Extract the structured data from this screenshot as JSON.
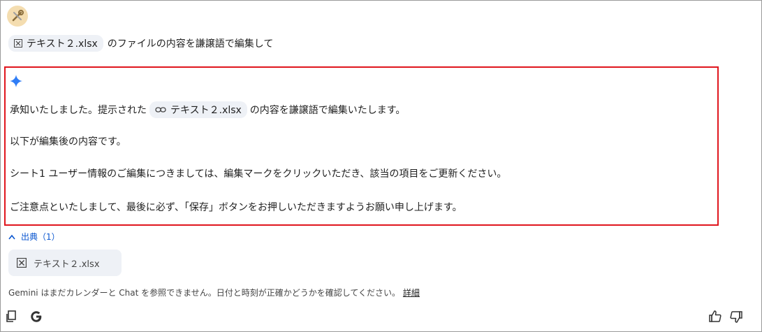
{
  "prompt": {
    "file_chip": "テキスト２.xlsx",
    "text": "のファイルの内容を謙譲語で編集して"
  },
  "response": {
    "line1_before": "承知いたしました。提示された",
    "line1_chip": "テキスト２.xlsx",
    "line1_after": "の内容を謙譲語で編集いたします。",
    "line2": "以下が編集後の内容です。",
    "line3": "シート1 ユーザー情報のご編集につきましては、編集マークをクリックいただき、該当の項目をご更新ください。",
    "line4": "ご注意点といたしまして、最後に必ず、「保存」ボタンをお押しいただきますようお願い申し上げます。"
  },
  "sources": {
    "toggle_label": "出典（1）",
    "items": [
      "テキスト２.xlsx"
    ]
  },
  "footnote": {
    "text": "Gemini はまだカレンダーと Chat を参照できません。日付と時刻が正確かどうかを確認してください。",
    "link": "詳細"
  },
  "colors": {
    "accent": "#0b57d0",
    "highlight_border": "#e0161e",
    "chip_bg": "#eef1f6"
  }
}
